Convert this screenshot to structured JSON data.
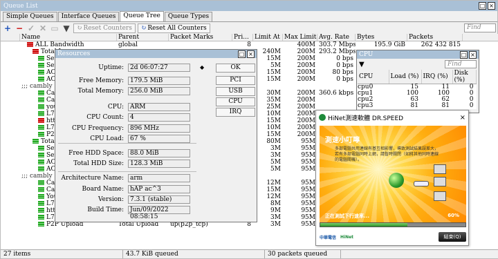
{
  "window": {
    "title": "Queue List"
  },
  "tabs": [
    "Simple Queues",
    "Interface Queues",
    "Queue Tree",
    "Queue Types"
  ],
  "active_tab": 2,
  "toolbar": {
    "reset_counters": "Reset Counters",
    "reset_all_counters": "Reset All Counters",
    "find_placeholder": "Find"
  },
  "columns": [
    "",
    "Name",
    "Parent",
    "Packet Marks",
    "Pri...",
    "Limit At ...",
    "Max Limit ...",
    "Avg. Rate",
    "Bytes",
    "Packets"
  ],
  "rows": [
    {
      "icon": "red",
      "indent": 10,
      "name": "ALL Bandwidth",
      "parent": "global",
      "marks": "",
      "pri": "8",
      "limit": "",
      "max": "400M",
      "rate": "303.7 Mbps",
      "bytes": "195.9 GiB",
      "packets": "262 432 815"
    },
    {
      "icon": "red",
      "indent": 18,
      "name": "Total L",
      "parent": "",
      "marks": "",
      "pri": "",
      "limit": "240M",
      "max": "200M",
      "rate": "293.2 Mbps",
      "bytes": "",
      "packets": ""
    },
    {
      "icon": "green",
      "indent": 26,
      "name": "Serv",
      "parent": "",
      "marks": "",
      "pri": "",
      "limit": "15M",
      "max": "200M",
      "rate": "0 bps",
      "bytes": "",
      "packets": ""
    },
    {
      "icon": "green",
      "indent": 26,
      "name": "Serv",
      "parent": "",
      "marks": "",
      "pri": "",
      "limit": "5M",
      "max": "200M",
      "rate": "0 bps",
      "bytes": "",
      "packets": ""
    },
    {
      "icon": "green",
      "indent": 26,
      "name": "AOI",
      "parent": "",
      "marks": "",
      "pri": "",
      "limit": "15M",
      "max": "200M",
      "rate": "80 bps",
      "bytes": "",
      "packets": ""
    },
    {
      "icon": "green",
      "indent": 26,
      "name": "AOI",
      "parent": "",
      "marks": "",
      "pri": "",
      "limit": "15M",
      "max": "200M",
      "rate": "0 bps",
      "bytes": "",
      "packets": ""
    },
    {
      "icon": "",
      "indent": 2,
      "name": ";;; cambly",
      "parent": "",
      "marks": "",
      "pri": "",
      "limit": "",
      "max": "",
      "rate": "",
      "bytes": "",
      "packets": ""
    },
    {
      "icon": "green",
      "indent": 26,
      "name": "Cam",
      "parent": "",
      "marks": "",
      "pri": "",
      "limit": "30M",
      "max": "200M",
      "rate": "360.6 kbps",
      "bytes": "",
      "packets": ""
    },
    {
      "icon": "green",
      "indent": 26,
      "name": "Cam",
      "parent": "",
      "marks": "",
      "pri": "",
      "limit": "35M",
      "max": "200M",
      "rate": "",
      "bytes": "",
      "packets": ""
    },
    {
      "icon": "green",
      "indent": 26,
      "name": "yout",
      "parent": "",
      "marks": "",
      "pri": "",
      "limit": "25M",
      "max": "200M",
      "rate": "",
      "bytes": "",
      "packets": ""
    },
    {
      "icon": "green",
      "indent": 26,
      "name": "L7",
      "parent": "",
      "marks": "",
      "pri": "",
      "limit": "10M",
      "max": "200M",
      "rate": "",
      "bytes": "",
      "packets": ""
    },
    {
      "icon": "red",
      "indent": 26,
      "name": "http",
      "parent": "",
      "marks": "",
      "pri": "",
      "limit": "15M",
      "max": "200M",
      "rate": "",
      "bytes": "",
      "packets": ""
    },
    {
      "icon": "green",
      "indent": 26,
      "name": "L7",
      "parent": "",
      "marks": "",
      "pri": "",
      "limit": "10M",
      "max": "200M",
      "rate": "",
      "bytes": "",
      "packets": ""
    },
    {
      "icon": "green",
      "indent": 26,
      "name": "P2P",
      "parent": "",
      "marks": "",
      "pri": "",
      "limit": "15M",
      "max": "200M",
      "rate": "",
      "bytes": "",
      "packets": ""
    },
    {
      "icon": "green",
      "indent": 18,
      "name": "Total U",
      "parent": "",
      "marks": "",
      "pri": "",
      "limit": "80M",
      "max": "95M",
      "rate": "",
      "bytes": "",
      "packets": ""
    },
    {
      "icon": "green",
      "indent": 26,
      "name": "Serv",
      "parent": "",
      "marks": "",
      "pri": "",
      "limit": "3M",
      "max": "95M",
      "rate": "",
      "bytes": "",
      "packets": ""
    },
    {
      "icon": "green",
      "indent": 26,
      "name": "Serv",
      "parent": "",
      "marks": "",
      "pri": "",
      "limit": "3M",
      "max": "95M",
      "rate": "",
      "bytes": "",
      "packets": ""
    },
    {
      "icon": "green",
      "indent": 26,
      "name": "AOI",
      "parent": "",
      "marks": "",
      "pri": "",
      "limit": "5M",
      "max": "95M",
      "rate": "",
      "bytes": "",
      "packets": ""
    },
    {
      "icon": "green",
      "indent": 26,
      "name": "AOI",
      "parent": "",
      "marks": "",
      "pri": "",
      "limit": "5M",
      "max": "95M",
      "rate": "",
      "bytes": "",
      "packets": ""
    },
    {
      "icon": "",
      "indent": 2,
      "name": ";;; cambly",
      "parent": "",
      "marks": "",
      "pri": "",
      "limit": "",
      "max": "",
      "rate": "",
      "bytes": "",
      "packets": ""
    },
    {
      "icon": "green",
      "indent": 26,
      "name": "Cam",
      "parent": "",
      "marks": "",
      "pri": "",
      "limit": "12M",
      "max": "95M",
      "rate": "",
      "bytes": "",
      "packets": ""
    },
    {
      "icon": "green",
      "indent": 26,
      "name": "Cam",
      "parent": "",
      "marks": "",
      "pri": "",
      "limit": "15M",
      "max": "95M",
      "rate": "",
      "bytes": "",
      "packets": ""
    },
    {
      "icon": "green",
      "indent": 26,
      "name": "Yout",
      "parent": "",
      "marks": "",
      "pri": "",
      "limit": "12M",
      "max": "95M",
      "rate": "",
      "bytes": "",
      "packets": ""
    },
    {
      "icon": "green",
      "indent": 26,
      "name": "L7",
      "parent": "",
      "marks": "",
      "pri": "",
      "limit": "8M",
      "max": "95M",
      "rate": "",
      "bytes": "",
      "packets": ""
    },
    {
      "icon": "green",
      "indent": 26,
      "name": "http",
      "parent": "",
      "marks": "",
      "pri": "",
      "limit": "9M",
      "max": "95M",
      "rate": "",
      "bytes": "",
      "packets": ""
    },
    {
      "icon": "green",
      "indent": 26,
      "name": "L7_Bittorent_Upload",
      "parent": "Total Upload",
      "marks": "upload(L7_Bittorent)",
      "pri": "7",
      "limit": "3M",
      "max": "95M",
      "rate": "",
      "bytes": "",
      "packets": ""
    },
    {
      "icon": "green",
      "indent": 26,
      "name": "P2P Upload",
      "parent": "Total Upload",
      "marks": "up(p2p_tcp)",
      "pri": "8",
      "limit": "3M",
      "max": "95M",
      "rate": "",
      "bytes": "",
      "packets": ""
    }
  ],
  "status": {
    "items": "27 items",
    "queued_bytes": "43.7 KiB queued",
    "queued_packets": "30 packets queued"
  },
  "resources": {
    "title": "Resources",
    "fields": [
      {
        "label": "Uptime:",
        "value": "2d 06:07:27"
      },
      {
        "label": "Free Memory:",
        "value": "179.5 MiB"
      },
      {
        "label": "Total Memory:",
        "value": "256.0 MiB"
      },
      {
        "label": "CPU:",
        "value": "ARM"
      },
      {
        "label": "CPU Count:",
        "value": "4"
      },
      {
        "label": "CPU Frequency:",
        "value": "896 MHz"
      },
      {
        "label": "CPU Load:",
        "value": "67 %"
      },
      {
        "label": "Free HDD Space:",
        "value": "88.0 MiB"
      },
      {
        "label": "Total HDD Size:",
        "value": "128.3 MiB"
      },
      {
        "label": "Architecture Name:",
        "value": "arm"
      },
      {
        "label": "Board Name:",
        "value": "hAP ac^3"
      },
      {
        "label": "Version:",
        "value": "7.3.1 (stable)"
      },
      {
        "label": "Build Time:",
        "value": "Jun/09/2022 08:58:15"
      }
    ],
    "buttons": [
      "OK",
      "PCI",
      "USB",
      "CPU",
      "IRQ"
    ]
  },
  "cpu": {
    "title": "CPU",
    "find_placeholder": "Find",
    "columns": [
      "CPU",
      "Load (%)",
      "IRQ (%)",
      "Disk (%)"
    ],
    "rows": [
      [
        "cpu0",
        "15",
        "11",
        "0"
      ],
      [
        "cpu1",
        "100",
        "100",
        "0"
      ],
      [
        "cpu2",
        "63",
        "62",
        "0"
      ],
      [
        "cpu3",
        "81",
        "81",
        "0"
      ]
    ]
  },
  "speedtest": {
    "title": "HiNet測速軟體 DR.SPEED",
    "heading": "測速小叮嚀",
    "message": "多部電腦共用連線有基互相影響，導致測試結果誤差大，若有多部電腦同時上網，請暫時關閉（如將其他同時連線的電腦關機）。",
    "status": "正在測試下行速率...",
    "progress_pct": "60%",
    "progress": 0.6,
    "brand1": "中華電信",
    "brand2": "HiNet",
    "end_button": "結束(Q)"
  }
}
